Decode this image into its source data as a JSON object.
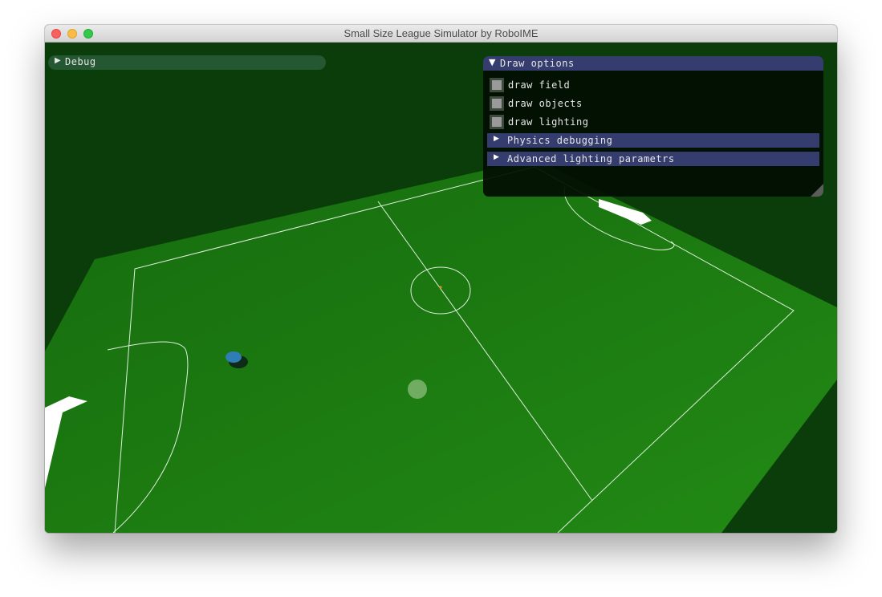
{
  "window": {
    "title": "Small Size League Simulator by RoboIME"
  },
  "debug_window": {
    "label": "Debug",
    "collapsed_icon": "triangle-right-icon"
  },
  "draw_options": {
    "title": "Draw options",
    "expanded_icon": "triangle-down-icon",
    "checkboxes": [
      {
        "label": "draw field",
        "checked": false
      },
      {
        "label": "draw objects",
        "checked": false
      },
      {
        "label": "draw lighting",
        "checked": false
      }
    ],
    "sections": [
      {
        "label": "Physics debugging",
        "collapsed": true
      },
      {
        "label": "Advanced lighting parametrs",
        "collapsed": true
      }
    ]
  },
  "colors": {
    "background": "#0b3d0b",
    "field": "#1c7a11",
    "field_lines": "#ffffff",
    "robot": "#2f7db4",
    "panel_header": "#353c6e"
  }
}
